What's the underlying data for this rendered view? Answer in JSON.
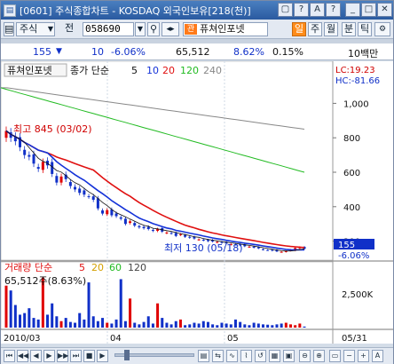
{
  "titlebar": {
    "title": "[0601] 주식종합차트 - KOSDAQ 외국인보유[218(천)]",
    "buttons": [
      "▢",
      "?",
      "A",
      "?",
      "_",
      "□",
      "✕"
    ]
  },
  "toolbar": {
    "market_select": "주식",
    "jeon_label": "전",
    "code_value": "058690",
    "stock_name": "퓨쳐인포넷",
    "badge": "관",
    "right_buttons": [
      "일",
      "주",
      "월",
      "분",
      "틱"
    ]
  },
  "infobar": {
    "change": "155",
    "arrow": "▼",
    "diff": "10",
    "diff_pct": "-6.06%",
    "volume": "65,512",
    "turnover_pct": "8.62%",
    "foreign_pct": "0.15%",
    "unit_label": "10백만"
  },
  "price_panel": {
    "legend_name": "퓨쳐인포넷",
    "legend_ma_label": "종가 단순",
    "ma_periods": [
      "5",
      "10",
      "20",
      "120",
      "240"
    ],
    "lc": "LC:19.23",
    "hc": "HC:-81.66",
    "high_label": "최고 845 (03/02)",
    "low_label": "최저 130 (05/18)",
    "last_price": "155",
    "last_pct": "-6.06%",
    "y_ticks": [
      "1,000",
      "800",
      "600",
      "400",
      "200"
    ]
  },
  "volume_panel": {
    "legend_label": "거래량 단순",
    "ma_periods": [
      "5",
      "20",
      "60",
      "120"
    ],
    "last_value": "65,512주(8.63%)",
    "y_ticks": [
      "2,500K"
    ]
  },
  "x_axis": {
    "labels": [
      "2010/03",
      "04",
      "05",
      "05/31"
    ]
  },
  "colors": {
    "up": "#e00000",
    "down": "#1030c8",
    "ma5": "#111111",
    "ma10": "#1432d8",
    "ma20": "#e01010",
    "ma120": "#22bb22",
    "ma240": "#888888"
  },
  "chart_data": {
    "type": "candlestick",
    "x_range": [
      "2010/03/02",
      "2010/05/31"
    ],
    "ylim": [
      0,
      1100
    ],
    "closes": [
      840,
      800,
      780,
      745,
      700,
      690,
      650,
      620,
      660,
      640,
      590,
      540,
      575,
      560,
      520,
      500,
      480,
      470,
      460,
      440,
      390,
      360,
      380,
      350,
      345,
      330,
      300,
      315,
      290,
      280,
      275,
      270,
      260,
      270,
      255,
      250,
      245,
      230,
      240,
      225,
      220,
      215,
      210,
      205,
      200,
      198,
      195,
      190,
      186,
      182,
      180,
      176,
      170,
      168,
      162,
      158,
      150,
      148,
      145,
      140,
      138,
      142,
      150,
      160,
      165,
      155
    ],
    "ma120": [
      1090,
      1080,
      1070,
      1060,
      1050,
      1040,
      1030,
      1020,
      1010,
      1000,
      990,
      980,
      970,
      960,
      950,
      940,
      930,
      920,
      910,
      900,
      890,
      880,
      870,
      860,
      850,
      840,
      830,
      820,
      810,
      800,
      790,
      780,
      770,
      760,
      750,
      740,
      730,
      720,
      710,
      700,
      690,
      680,
      670,
      660,
      650,
      640,
      630,
      620,
      610,
      600
    ],
    "ma240": [
      1090,
      1090,
      1085,
      1080,
      1075,
      1070,
      1065,
      1060,
      1055,
      1050,
      1045,
      1040,
      1035,
      1030,
      1025,
      1020,
      1015,
      1010,
      1005,
      1000,
      995,
      990,
      985,
      980,
      975,
      970,
      965,
      960,
      955,
      950,
      945,
      940,
      935,
      930,
      925,
      920,
      915,
      910,
      905,
      900,
      895,
      890,
      885,
      880,
      875,
      870,
      865,
      860,
      855,
      850
    ],
    "volumes": [
      2600,
      2300,
      1400,
      800,
      900,
      1200,
      600,
      500,
      3100,
      800,
      1500,
      700,
      400,
      600,
      350,
      300,
      900,
      500,
      2800,
      700,
      400,
      600,
      300,
      250,
      500,
      3000,
      400,
      1800,
      300,
      200,
      350,
      700,
      250,
      1500,
      600,
      300,
      200,
      400,
      500,
      150,
      200,
      300,
      250,
      400,
      350,
      200,
      150,
      300,
      250,
      200,
      500,
      350,
      200,
      150,
      300,
      250,
      200,
      180,
      150,
      200,
      250,
      300,
      200,
      150,
      250,
      65
    ]
  }
}
